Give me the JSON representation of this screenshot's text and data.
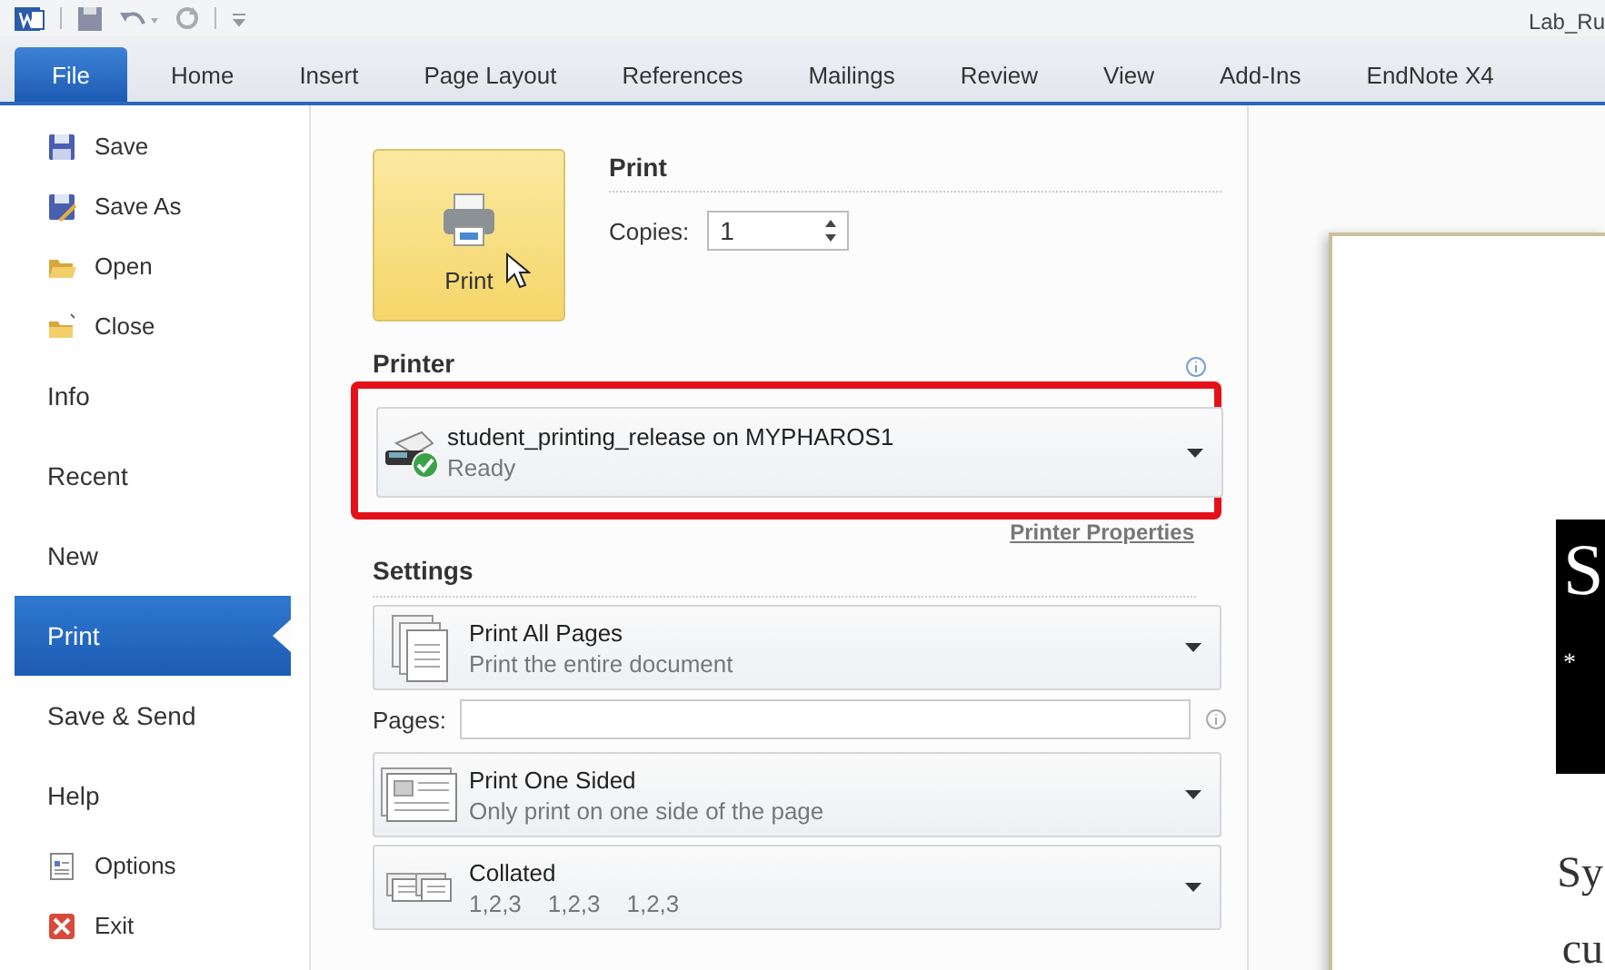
{
  "title_bar": {
    "title": "Lab_Ru"
  },
  "ribbon_tabs": [
    {
      "label": "File",
      "selected": true,
      "kind": "file"
    },
    {
      "label": "Home",
      "selected": false,
      "kind": "tab"
    },
    {
      "label": "Insert",
      "selected": false,
      "kind": "tab"
    },
    {
      "label": "Page Layout",
      "selected": false,
      "kind": "tab"
    },
    {
      "label": "References",
      "selected": false,
      "kind": "tab"
    },
    {
      "label": "Mailings",
      "selected": false,
      "kind": "tab"
    },
    {
      "label": "Review",
      "selected": false,
      "kind": "tab"
    },
    {
      "label": "View",
      "selected": false,
      "kind": "tab"
    },
    {
      "label": "Add-Ins",
      "selected": false,
      "kind": "tab"
    },
    {
      "label": "EndNote X4",
      "selected": false,
      "kind": "tab"
    }
  ],
  "backstage_menu": [
    {
      "label": "Save",
      "kind": "command",
      "selected": false
    },
    {
      "label": "Save As",
      "kind": "command",
      "selected": false
    },
    {
      "label": "Open",
      "kind": "command",
      "selected": false
    },
    {
      "label": "Close",
      "kind": "command",
      "selected": false
    },
    {
      "label": "Info",
      "kind": "page",
      "selected": false
    },
    {
      "label": "Recent",
      "kind": "page",
      "selected": false
    },
    {
      "label": "New",
      "kind": "page",
      "selected": false
    },
    {
      "label": "Print",
      "kind": "page",
      "selected": true
    },
    {
      "label": "Save & Send",
      "kind": "page",
      "selected": false
    },
    {
      "label": "Help",
      "kind": "page",
      "selected": false
    },
    {
      "label": "Options",
      "kind": "command",
      "selected": false
    },
    {
      "label": "Exit",
      "kind": "command",
      "selected": false
    }
  ],
  "print": {
    "button": "Print",
    "heading": "Print",
    "copies_label": "Copies:",
    "copies": "1"
  },
  "printer": {
    "heading": "Printer",
    "name": "student_printing_release on MYPHAROS1",
    "status": "Ready",
    "highlighted": true,
    "properties_link": "Printer Properties"
  },
  "settings": {
    "heading": "Settings",
    "items": [
      {
        "kind": "dropdown",
        "title": "Print All Pages",
        "subtitle": "Print the entire document"
      },
      {
        "kind": "field",
        "label": "Pages:"
      },
      {
        "kind": "dropdown",
        "title": "Print One Sided",
        "subtitle": "Only print on one side of the page"
      },
      {
        "kind": "dropdown",
        "title": "Collated",
        "subtitle": "1,2,3    1,2,3    1,2,3"
      }
    ]
  },
  "preview": {
    "block_letter": "S",
    "block_mark": "*",
    "lines": [
      "Sy",
      "cu"
    ]
  }
}
